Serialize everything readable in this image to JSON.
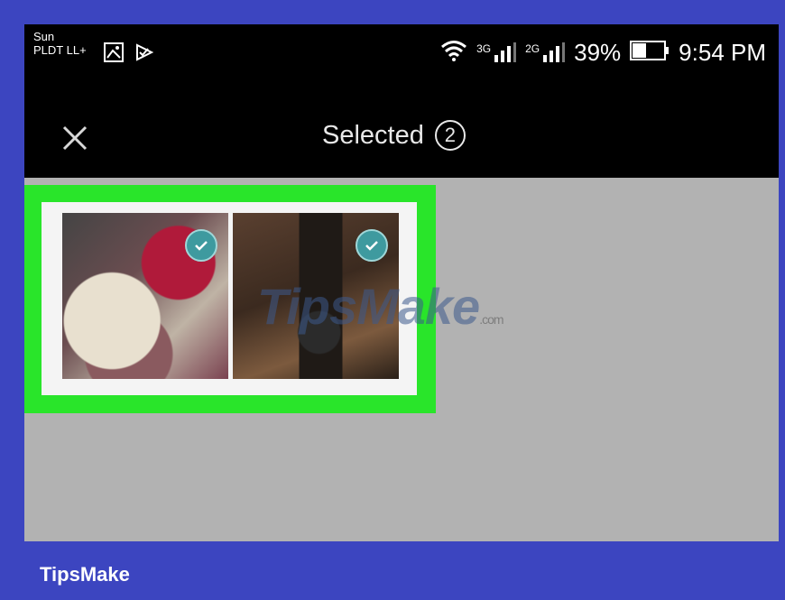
{
  "status_bar": {
    "carrier_line1": "Sun",
    "carrier_line2": "PLDT LL+",
    "net_3g": "3G",
    "net_2g": "2G",
    "battery": "39%",
    "time": "9:54 PM",
    "icons": [
      "image-icon",
      "check-flag-icon",
      "wifi-icon",
      "signal-icon",
      "battery-icon"
    ]
  },
  "toolbar": {
    "title": "Selected",
    "count": "2"
  },
  "photos": [
    {
      "subject": "cupcake",
      "selected": true
    },
    {
      "subject": "camera",
      "selected": true
    }
  ],
  "watermark": {
    "text": "TipsMake",
    "suffix": ".com"
  },
  "footer": {
    "brand": "TipsMake"
  },
  "colors": {
    "highlight": "#29e52a",
    "border": "#3c45c0",
    "check": "#3e9a9f"
  }
}
